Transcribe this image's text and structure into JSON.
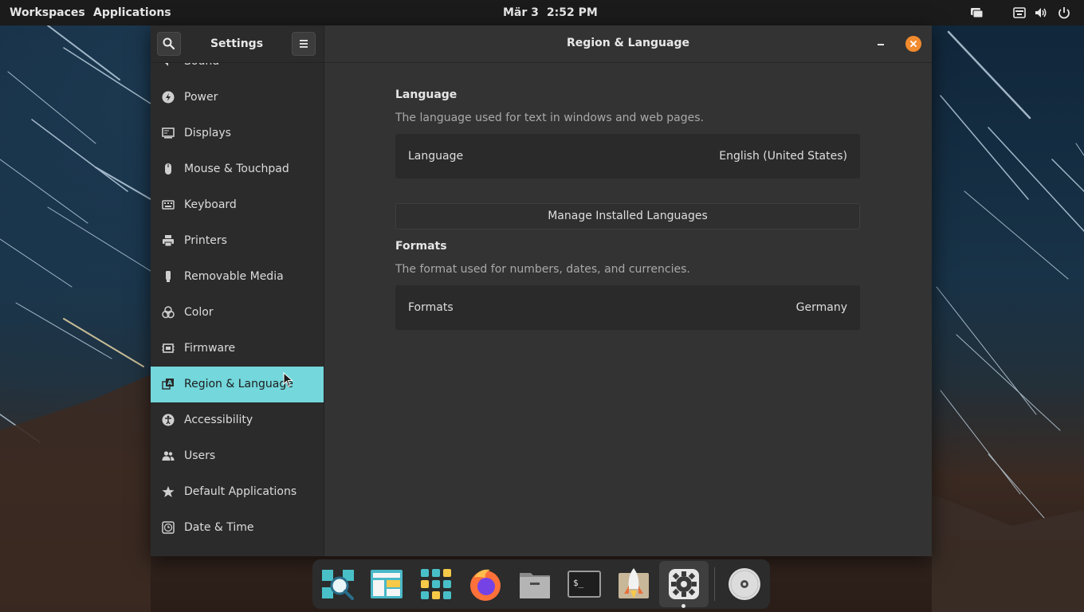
{
  "topbar": {
    "workspaces": "Workspaces",
    "applications": "Applications",
    "date": "Mär 3",
    "time": "2:52 PM",
    "tray_icons": [
      "notifications-icon",
      "keyboard-icon",
      "volume-icon",
      "power-icon"
    ]
  },
  "window": {
    "sidebar_title": "Settings",
    "sidebar_items": [
      {
        "label": "Sound",
        "icon": "sound-icon"
      },
      {
        "label": "Power",
        "icon": "power-icon"
      },
      {
        "label": "Displays",
        "icon": "display-icon"
      },
      {
        "label": "Mouse & Touchpad",
        "icon": "mouse-icon"
      },
      {
        "label": "Keyboard",
        "icon": "keyboard-icon"
      },
      {
        "label": "Printers",
        "icon": "printer-icon"
      },
      {
        "label": "Removable Media",
        "icon": "usb-icon"
      },
      {
        "label": "Color",
        "icon": "color-icon"
      },
      {
        "label": "Firmware",
        "icon": "chip-icon"
      },
      {
        "label": "Region & Language",
        "icon": "region-icon",
        "active": true
      },
      {
        "label": "Accessibility",
        "icon": "accessibility-icon"
      },
      {
        "label": "Users",
        "icon": "users-icon"
      },
      {
        "label": "Default Applications",
        "icon": "star-icon"
      },
      {
        "label": "Date & Time",
        "icon": "clock-icon"
      }
    ],
    "content_title": "Region & Language",
    "language": {
      "section_title": "Language",
      "description": "The language used for text in windows and web pages.",
      "row_label": "Language",
      "row_value": "English (United States)",
      "manage_button": "Manage Installed Languages"
    },
    "formats": {
      "section_title": "Formats",
      "description": "The format used for numbers, dates, and currencies.",
      "row_label": "Formats",
      "row_value": "Germany"
    }
  },
  "dock": {
    "apps": [
      "search-app-icon",
      "workspaces-app-icon",
      "app-grid-icon",
      "firefox-icon",
      "files-icon",
      "terminal-icon",
      "launcher-rocket-icon",
      "settings-icon",
      "disc-icon"
    ],
    "active_app": "settings-icon"
  },
  "colors": {
    "accent": "#73d7dc",
    "close": "#f28a2e",
    "window_bg": "#333333",
    "sidebar_bg": "#2b2b2b"
  }
}
